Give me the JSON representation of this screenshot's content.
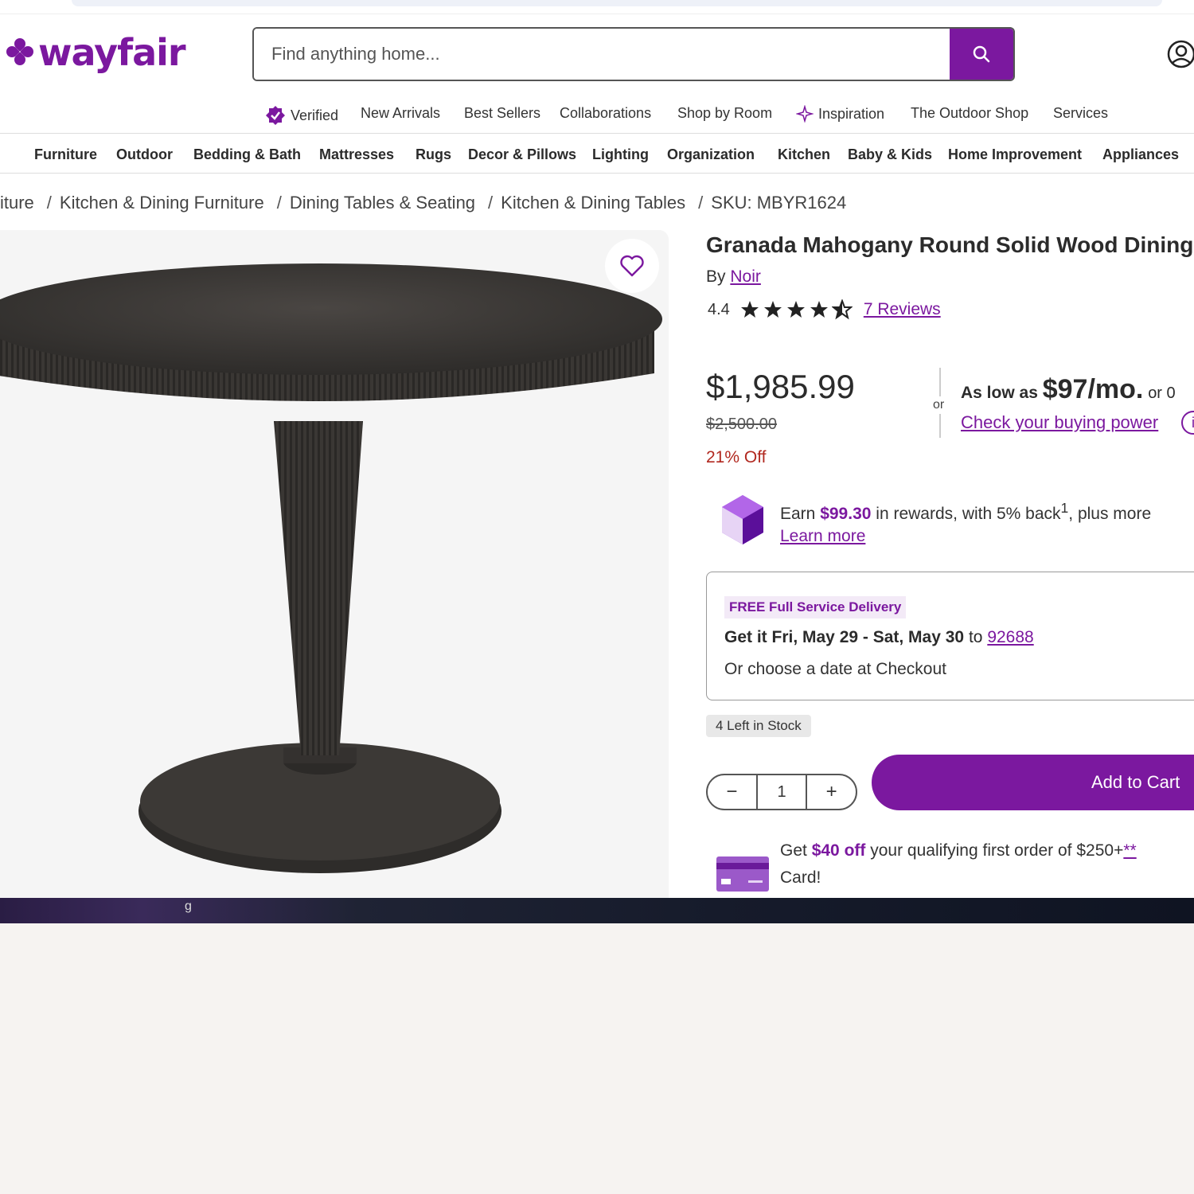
{
  "search": {
    "placeholder": "Find anything home..."
  },
  "brand": {
    "name": "wayfair",
    "color": "#7b189f"
  },
  "subnav": [
    "Verified",
    "New Arrivals",
    "Best Sellers",
    "Collaborations",
    "Shop by Room",
    "Inspiration",
    "The Outdoor Shop",
    "Services"
  ],
  "categories": [
    "Furniture",
    "Outdoor",
    "Bedding & Bath",
    "Mattresses",
    "Rugs",
    "Decor & Pillows",
    "Lighting",
    "Organization",
    "Kitchen",
    "Baby & Kids",
    "Home Improvement",
    "Appliances"
  ],
  "breadcrumbs": [
    "iture",
    "Kitchen & Dining Furniture",
    "Dining Tables & Seating",
    "Kitchen & Dining Tables",
    "SKU: MBYR1624"
  ],
  "product": {
    "title": "Granada Mahogany Round Solid Wood Dining",
    "by_prefix": "By",
    "brand": "Noir",
    "rating": "4.4",
    "stars": 4.4,
    "reviews": "7 Reviews",
    "price": "$1,985.99",
    "was_price": "$2,500.00",
    "discount": "21% Off",
    "or_label": "or",
    "financing_prefix": "As low as",
    "financing_amount": "$97/mo.",
    "financing_suffix": "or 0",
    "buying_power": "Check your buying power",
    "info_glyph": "i"
  },
  "rewards": {
    "prefix": "Earn",
    "amount": "$99.30",
    "middle": "in rewards, with 5% back",
    "sup": "1",
    "suffix": ", plus more",
    "learn_more": "Learn more"
  },
  "delivery": {
    "tag": "FREE Full Service Delivery",
    "when_bold": "Get it Fri, May 29 - Sat, May 30",
    "to": "to",
    "zip": "92688",
    "choose": "Or choose a date at Checkout"
  },
  "stock": "4 Left in Stock",
  "quantity": {
    "minus": "−",
    "value": "1",
    "plus": "+"
  },
  "cart_label": "Add to Cart",
  "offer": {
    "prefix": "Get",
    "amount": "$40 off",
    "middle": "your qualifying first order of $250+",
    "link": "**",
    "line2": "Card!"
  },
  "bottom_glyph": "g"
}
